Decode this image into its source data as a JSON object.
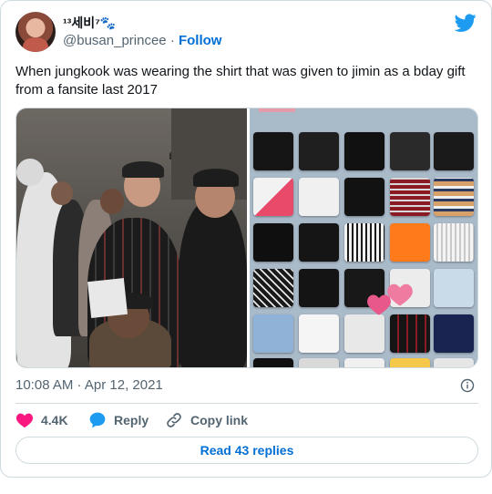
{
  "user": {
    "display_name": "¹³세비⁷🐾",
    "handle": "@busan_princee",
    "separator": "·",
    "follow_label": "Follow"
  },
  "tweet": {
    "text": "When jungkook was wearing the shirt that was given to jimin as a bday gift from a fansite last 2017",
    "timestamp": "10:08 AM · Apr 12, 2021"
  },
  "actions": {
    "like_count": "4.4K",
    "reply_label": "Reply",
    "copy_link_label": "Copy link"
  },
  "footer": {
    "read_replies_label": "Read 43 replies"
  },
  "colors": {
    "twitter_blue": "#1d9bf0",
    "link_blue": "#006fd6",
    "like_pink": "#f91880",
    "secondary_text": "#536471",
    "border": "#cfd9de"
  },
  "icons": {
    "brand": "twitter-bird-icon",
    "info": "info-circle-icon",
    "like": "heart-icon",
    "reply": "speech-bubble-icon",
    "copy_link": "link-icon"
  }
}
